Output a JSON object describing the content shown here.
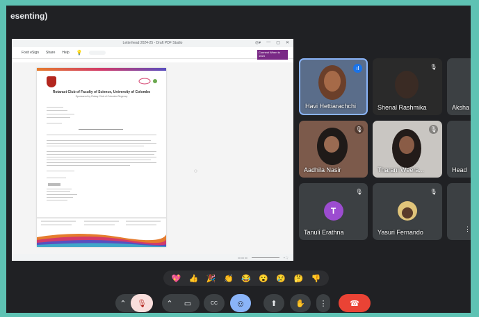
{
  "presenting_title": "esenting)",
  "shared_window": {
    "title": "Letterhead 2024-25 - Draft PDF Studio",
    "menu": [
      "Foxit eSign",
      "Share",
      "Help"
    ],
    "notice": "Connect\nWhen to 1024"
  },
  "document": {
    "org_name": "Rotaract Club of Faculty of Science, University of Colombo",
    "org_sub": "Sponsored by Rotary Club of Colombo Regency"
  },
  "participants": [
    {
      "name": "Havi Hettiarachchi",
      "mic": "speaking"
    },
    {
      "name": "Shenal Rashmika",
      "mic": "muted"
    },
    {
      "name": "Aksha",
      "mic": "none"
    },
    {
      "name": "Aadhila Nasir",
      "mic": "muted"
    },
    {
      "name": "Tharani Weera...",
      "mic": "muted"
    },
    {
      "name": "Head",
      "mic": "none"
    },
    {
      "name": "Tanuli Erathna",
      "mic": "muted",
      "initial": "T"
    },
    {
      "name": "Yasuri Fernando",
      "mic": "muted"
    }
  ],
  "reactions": [
    "💖",
    "👍",
    "🎉",
    "👏",
    "😂",
    "😮",
    "😢",
    "🤔",
    "👎"
  ],
  "colors": {
    "frame_border": "#5ec2b3",
    "meet_bg": "#202124",
    "end_call": "#ea4335",
    "active_button": "#8ab4f8",
    "mic_muted": "#f28b82",
    "avatar_purple": "#9c4cd0"
  },
  "icons": {
    "expand": "⌃",
    "mic_off": "🎙",
    "camera": "▭",
    "captions": "CC",
    "emoji": "☺",
    "present": "⬆",
    "hand": "✋",
    "more": "⋮",
    "end_call": "☎"
  }
}
